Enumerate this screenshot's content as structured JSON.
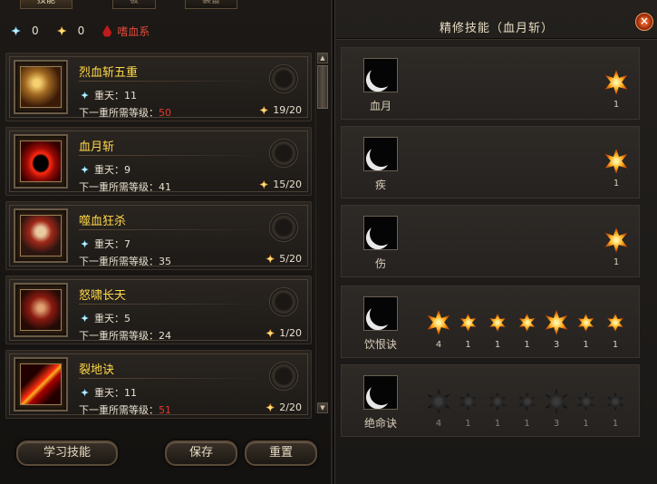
{
  "tabs": [
    {
      "label": "技能",
      "active": true
    },
    {
      "label": "被",
      "active": false
    },
    {
      "label": "装备",
      "active": false
    }
  ],
  "currency": {
    "blue_count": "0",
    "orange_count": "0",
    "school_name": "嗜血系"
  },
  "skills": [
    {
      "name": "烈血斩五重",
      "star_label": "重天：11",
      "req_label": "下一重所需等级：",
      "req_level": "50",
      "req_level_red": true,
      "cost": "19/20",
      "icon": "blood-axe-icon"
    },
    {
      "name": "血月斩",
      "star_label": "重天：9",
      "req_label": "下一重所需等级：",
      "req_level": "41",
      "req_level_red": false,
      "cost": "15/20",
      "icon": "blood-moon-icon"
    },
    {
      "name": "噬血狂杀",
      "star_label": "重天：7",
      "req_label": "下一重所需等级：",
      "req_level": "35",
      "req_level_red": false,
      "cost": "5/20",
      "icon": "green-skull-icon"
    },
    {
      "name": "怒啸长天",
      "star_label": "重天：5",
      "req_label": "下一重所需等级：",
      "req_level": "24",
      "req_level_red": false,
      "cost": "1/20",
      "icon": "roaring-demon-icon"
    },
    {
      "name": "裂地诀",
      "star_label": "重天：11",
      "req_label": "下一重所需等级：",
      "req_level": "51",
      "req_level_red": true,
      "cost": "2/20",
      "icon": "earth-split-icon"
    }
  ],
  "buttons": {
    "learn": "学习技能",
    "save": "保存",
    "reset": "重置"
  },
  "refine": {
    "title": "精修技能（血月斩）",
    "close_symbol": "×",
    "rows": [
      {
        "label": "血月",
        "nodes": [
          {
            "value": "1",
            "lit": true,
            "big": true
          }
        ]
      },
      {
        "label": "疾",
        "nodes": [
          {
            "value": "1",
            "lit": true,
            "big": true
          }
        ]
      },
      {
        "label": "伤",
        "nodes": [
          {
            "value": "1",
            "lit": true,
            "big": true
          }
        ]
      },
      {
        "label": "饮恨诀",
        "nodes": [
          {
            "value": "4",
            "lit": true,
            "big": true
          },
          {
            "value": "1",
            "lit": true,
            "big": false
          },
          {
            "value": "1",
            "lit": true,
            "big": false
          },
          {
            "value": "1",
            "lit": true,
            "big": false
          },
          {
            "value": "3",
            "lit": true,
            "big": true
          },
          {
            "value": "1",
            "lit": true,
            "big": false
          },
          {
            "value": "1",
            "lit": true,
            "big": false
          }
        ]
      },
      {
        "label": "绝命诀",
        "nodes": [
          {
            "value": "4",
            "lit": false,
            "big": true
          },
          {
            "value": "1",
            "lit": false,
            "big": false
          },
          {
            "value": "1",
            "lit": false,
            "big": false
          },
          {
            "value": "1",
            "lit": false,
            "big": false
          },
          {
            "value": "3",
            "lit": false,
            "big": true
          },
          {
            "value": "1",
            "lit": false,
            "big": false
          },
          {
            "value": "1",
            "lit": false,
            "big": false
          }
        ]
      }
    ]
  },
  "colors": {
    "skill_name": "#ffd84a",
    "level_red": "#e23a2a",
    "school_red": "#e04a3a"
  }
}
